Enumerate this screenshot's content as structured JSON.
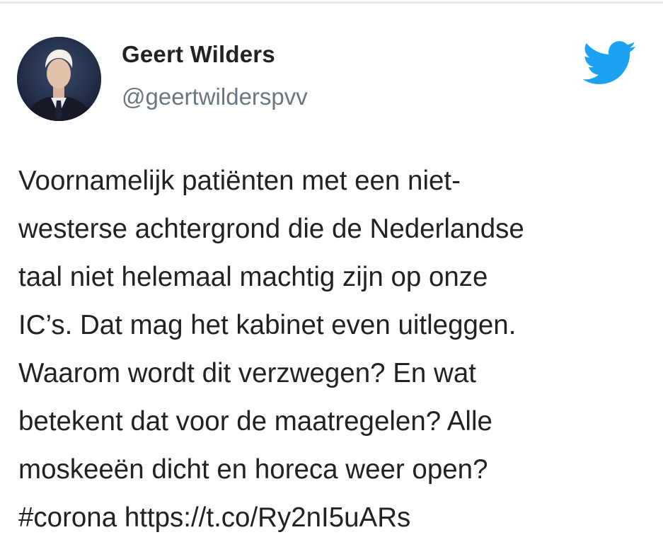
{
  "tweet": {
    "author_name": "Geert Wilders",
    "author_handle": "@geertwilderspvv",
    "text": "Voornamelijk patiënten met een niet-\nwesterse achtergrond die de Nederlandse\ntaal niet helemaal machtig zijn op onze\nIC’s. Dat mag het kabinet even uitleggen.\nWaarom wordt dit verzwegen? En wat\nbetekent dat voor de maatregelen? Alle\nmoskeeën dicht en horeca weer open?\n#corona https://t.co/Ry2nI5uARs",
    "brand_icon": "twitter-bird-icon"
  },
  "colors": {
    "brand": "#1da1f2",
    "name": "#222222",
    "handle": "#6b7780",
    "divider": "#e6e8ea"
  }
}
